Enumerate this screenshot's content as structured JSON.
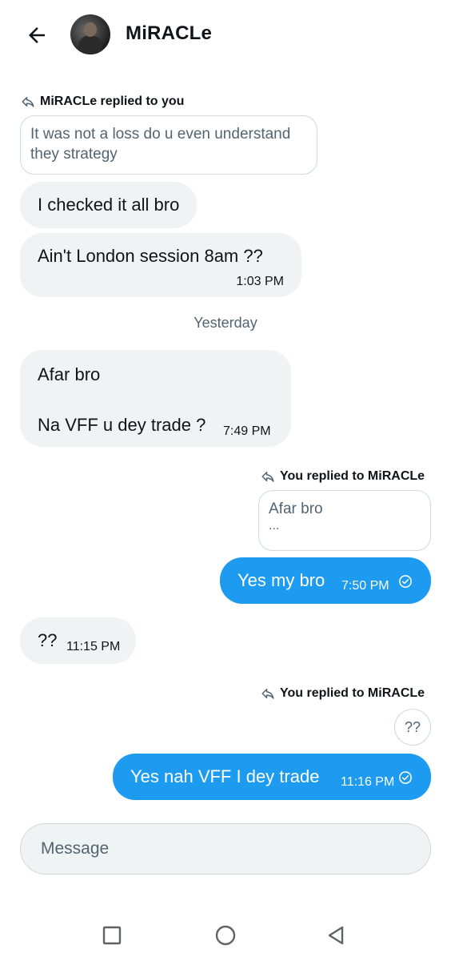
{
  "header": {
    "back_icon": "arrow-left-icon",
    "contact_name": "MiRACLe"
  },
  "messages": {
    "reply1": {
      "label": "MiRACLe replied to you",
      "quote": "It was not a loss do u even understand they strategy"
    },
    "m1": {
      "text": "I checked it all bro"
    },
    "m2": {
      "text": "Ain't London session 8am ??",
      "time": "1:03 PM"
    },
    "date_separator": "Yesterday",
    "m3": {
      "line1": "Afar bro",
      "line2": "Na VFF u dey trade ?",
      "time": "7:49 PM"
    },
    "reply2": {
      "label": "You replied to MiRACLe",
      "quote_line1": "Afar bro",
      "quote_line2": "..."
    },
    "m4": {
      "text": "Yes my bro",
      "time": "7:50 PM",
      "status_icon": "sent-check-icon"
    },
    "m5": {
      "text": "??",
      "time": "11:15 PM"
    },
    "reply3": {
      "label": "You replied to MiRACLe",
      "quote": "??"
    },
    "m6": {
      "text": "Yes nah VFF I dey trade",
      "time": "11:16 PM",
      "status_icon": "sent-check-icon"
    }
  },
  "composer": {
    "placeholder": "Message"
  },
  "nav": {
    "recents_icon": "square-icon",
    "home_icon": "circle-icon",
    "back_icon": "triangle-back-icon"
  },
  "colors": {
    "accent": "#1d9bf0",
    "incoming_bubble": "#eff3f4",
    "muted_text": "#536471"
  }
}
